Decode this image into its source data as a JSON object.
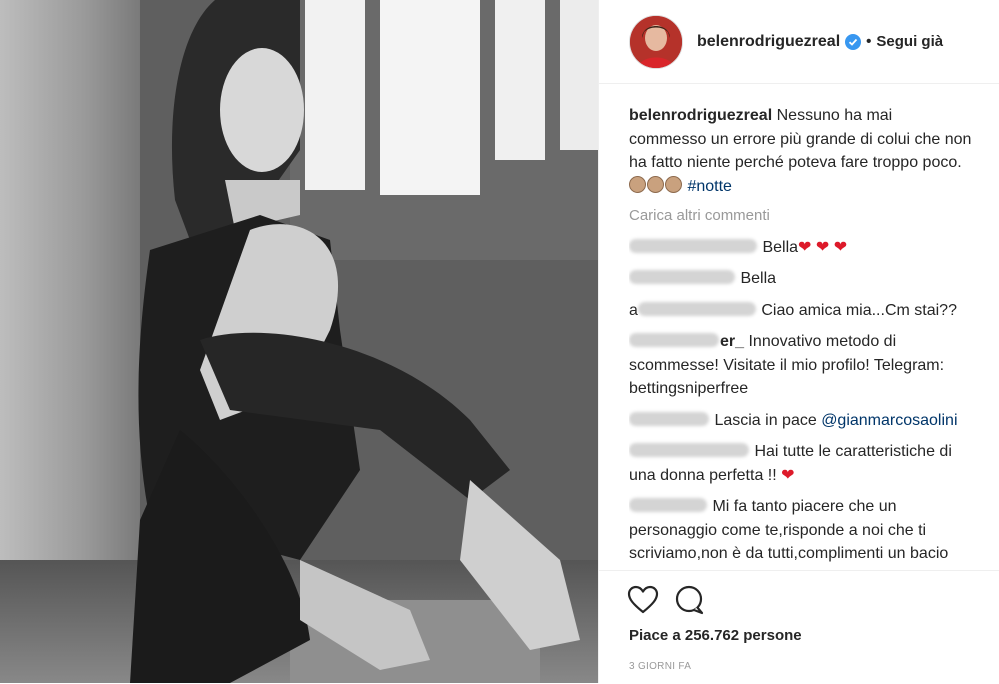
{
  "post": {
    "username": "belenrodriguezreal",
    "follow_separator": "•",
    "follow_label": "Segui già",
    "caption_text": "Nessuno ha mai commesso un errore più grande di colui che non ha fatto niente perché poteva fare troppo poco.",
    "caption_hashtag": "#notte",
    "load_more": "Carica altri commenti",
    "likes": "Piace a 256.762 persone",
    "date": "3 GIORNI FA"
  },
  "comments": [
    {
      "text": "Bella",
      "hearts": "❤ ❤ ❤"
    },
    {
      "text": "Bella"
    },
    {
      "prefix": "a",
      "text": " Ciao amica mia...Cm stai??"
    },
    {
      "suffix": "er_",
      "text": " Innovativo metodo di scommesse! Visitate il mio profilo! Telegram: bettingsniperfree"
    },
    {
      "text": "Lascia in pace ",
      "mention": "@gianmarcosaolini"
    },
    {
      "text": "Hai tutte le caratteristiche di una donna perfetta !! ",
      "hearts": "❤"
    },
    {
      "text": "Mi fa tanto piacere che un personaggio come te,risponde a noi che ti scriviamo,non è da tutti,complimenti un bacio affettuosissimo"
    }
  ],
  "colors": {
    "accent": "#3897f0",
    "link": "#003569",
    "heart": "#dd1a2a"
  },
  "icons": [
    "verified-badge-icon",
    "heart-outline-icon",
    "comment-bubble-icon"
  ]
}
